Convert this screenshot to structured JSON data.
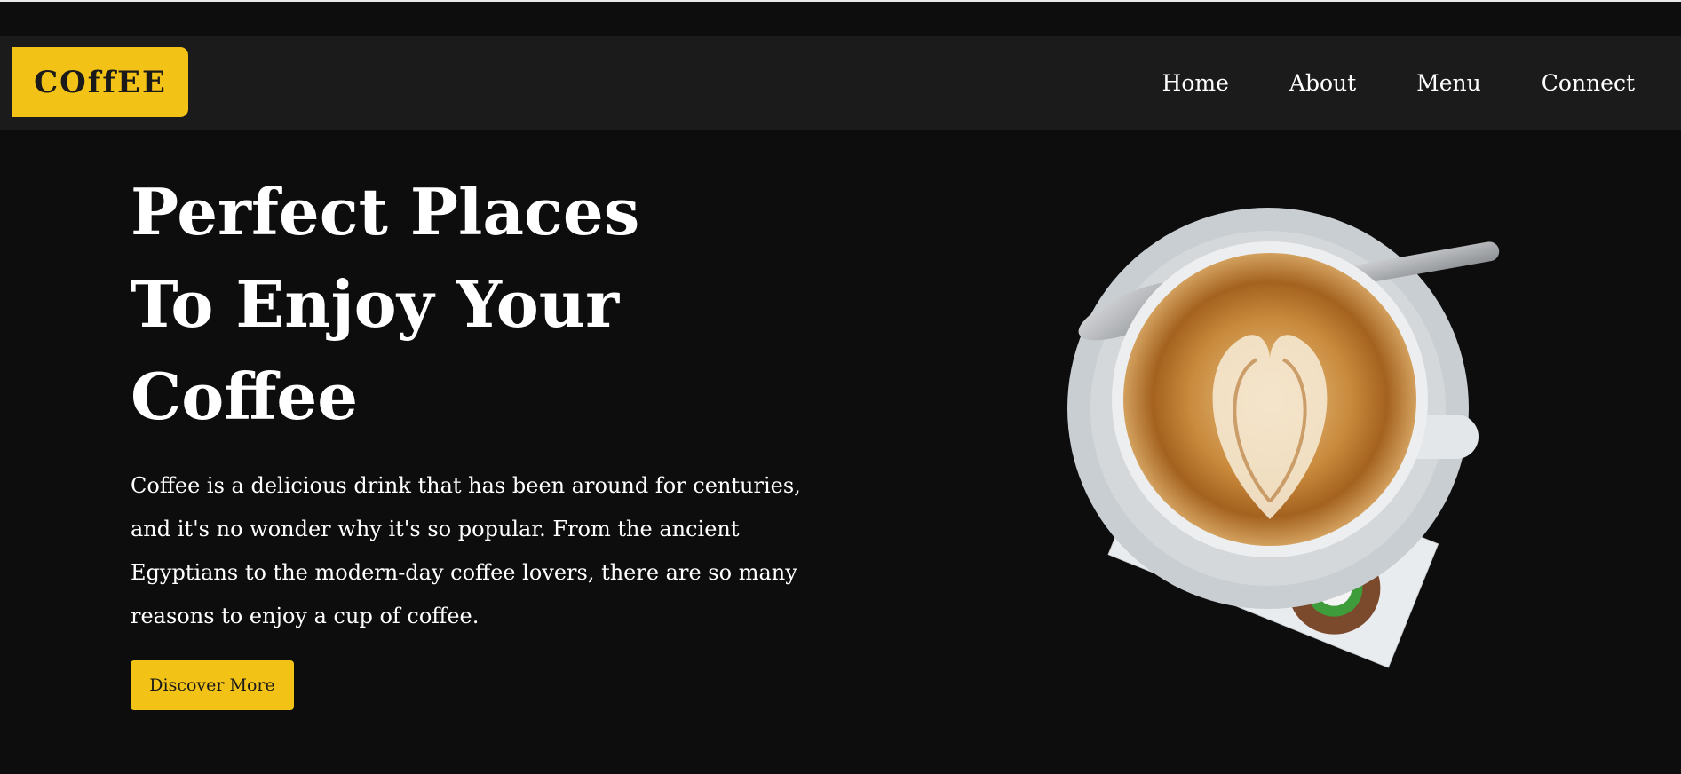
{
  "brand": {
    "logo_text": "COffEE",
    "accent_color": "#f2c316"
  },
  "nav": {
    "links": [
      "Home",
      "About",
      "Menu",
      "Connect"
    ]
  },
  "hero": {
    "title_lines": [
      "Perfect Places",
      "To Enjoy Your",
      "Coffee"
    ],
    "description": "Coffee is a delicious drink that has been around for centuries, and it's no wonder why it's so popular. From the ancient Egyptians to the modern-day coffee lovers, there are so many reasons to enjoy a cup of coffee.",
    "cta_label": "Discover More"
  },
  "colors": {
    "background": "#0d0d0e",
    "navbar": "#1b1b1b",
    "text": "#ffffff"
  }
}
